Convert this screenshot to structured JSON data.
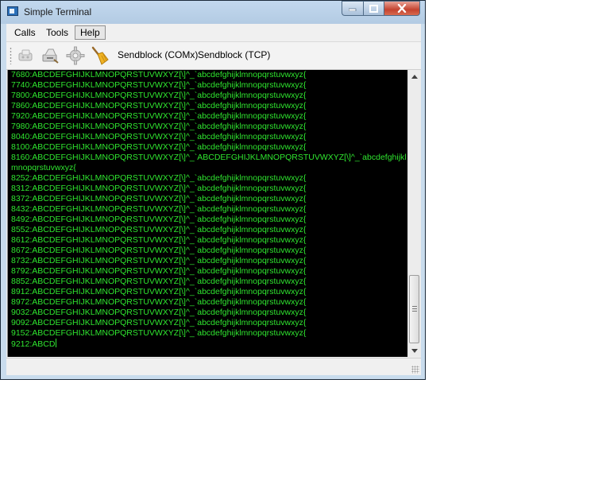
{
  "window": {
    "title": "Simple Terminal"
  },
  "menu": {
    "items": [
      "Calls",
      "Tools",
      "Help"
    ]
  },
  "toolbar": {
    "icons": [
      "connect-icon",
      "disconnect-icon",
      "settings-gear-icon",
      "clear-broom-icon"
    ],
    "sendblock_com": "Sendblock (COMx)",
    "sendblock_tcp": "Sendblock (TCP)"
  },
  "terminal": {
    "text_color": "#2fe52f",
    "background": "#000000",
    "lines": [
      "7680:ABCDEFGHIJKLMNOPQRSTUVWXYZ[\\]^_`abcdefghijklmnopqrstuvwxyz{",
      "7740:ABCDEFGHIJKLMNOPQRSTUVWXYZ[\\]^_`abcdefghijklmnopqrstuvwxyz{",
      "7800:ABCDEFGHIJKLMNOPQRSTUVWXYZ[\\]^_`abcdefghijklmnopqrstuvwxyz{",
      "7860:ABCDEFGHIJKLMNOPQRSTUVWXYZ[\\]^_`abcdefghijklmnopqrstuvwxyz{",
      "7920:ABCDEFGHIJKLMNOPQRSTUVWXYZ[\\]^_`abcdefghijklmnopqrstuvwxyz{",
      "7980:ABCDEFGHIJKLMNOPQRSTUVWXYZ[\\]^_`abcdefghijklmnopqrstuvwxyz{",
      "8040:ABCDEFGHIJKLMNOPQRSTUVWXYZ[\\]^_`abcdefghijklmnopqrstuvwxyz{",
      "8100:ABCDEFGHIJKLMNOPQRSTUVWXYZ[\\]^_`abcdefghijklmnopqrstuvwxyz{",
      "8160:ABCDEFGHIJKLMNOPQRSTUVWXYZ[\\]^_`ABCDEFGHIJKLMNOPQRSTUVWXYZ[\\]^_`abcdefghijkl",
      "mnopqrstuvwxyz{",
      "8252:ABCDEFGHIJKLMNOPQRSTUVWXYZ[\\]^_`abcdefghijklmnopqrstuvwxyz{",
      "8312:ABCDEFGHIJKLMNOPQRSTUVWXYZ[\\]^_`abcdefghijklmnopqrstuvwxyz{",
      "8372:ABCDEFGHIJKLMNOPQRSTUVWXYZ[\\]^_`abcdefghijklmnopqrstuvwxyz{",
      "8432:ABCDEFGHIJKLMNOPQRSTUVWXYZ[\\]^_`abcdefghijklmnopqrstuvwxyz{",
      "8492:ABCDEFGHIJKLMNOPQRSTUVWXYZ[\\]^_`abcdefghijklmnopqrstuvwxyz{",
      "8552:ABCDEFGHIJKLMNOPQRSTUVWXYZ[\\]^_`abcdefghijklmnopqrstuvwxyz{",
      "8612:ABCDEFGHIJKLMNOPQRSTUVWXYZ[\\]^_`abcdefghijklmnopqrstuvwxyz{",
      "8672:ABCDEFGHIJKLMNOPQRSTUVWXYZ[\\]^_`abcdefghijklmnopqrstuvwxyz{",
      "8732:ABCDEFGHIJKLMNOPQRSTUVWXYZ[\\]^_`abcdefghijklmnopqrstuvwxyz{",
      "8792:ABCDEFGHIJKLMNOPQRSTUVWXYZ[\\]^_`abcdefghijklmnopqrstuvwxyz{",
      "8852:ABCDEFGHIJKLMNOPQRSTUVWXYZ[\\]^_`abcdefghijklmnopqrstuvwxyz{",
      "8912:ABCDEFGHIJKLMNOPQRSTUVWXYZ[\\]^_`abcdefghijklmnopqrstuvwxyz{",
      "8972:ABCDEFGHIJKLMNOPQRSTUVWXYZ[\\]^_`abcdefghijklmnopqrstuvwxyz{",
      "9032:ABCDEFGHIJKLMNOPQRSTUVWXYZ[\\]^_`abcdefghijklmnopqrstuvwxyz{",
      "9092:ABCDEFGHIJKLMNOPQRSTUVWXYZ[\\]^_`abcdefghijklmnopqrstuvwxyz{",
      "9152:ABCDEFGHIJKLMNOPQRSTUVWXYZ[\\]^_`abcdefghijklmnopqrstuvwxyz{",
      "9212:ABCD"
    ]
  }
}
